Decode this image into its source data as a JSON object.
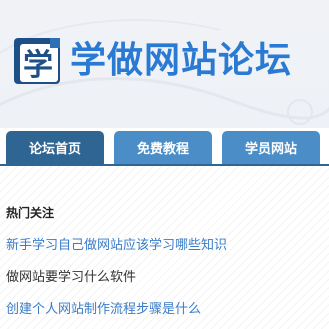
{
  "site": {
    "logo_glyph": "学",
    "title": "学做网站论坛",
    "brand_color": "#2a7ad4"
  },
  "nav": {
    "tabs": [
      {
        "label": "论坛首页",
        "active": true
      },
      {
        "label": "免费教程",
        "active": false
      },
      {
        "label": "学员网站",
        "active": false
      }
    ],
    "active_color": "#2f6592",
    "inactive_color": "#4a8dc7"
  },
  "hot": {
    "title": "热门关注",
    "links": [
      {
        "text": "新手学习自己做网站应该学习哪些知识"
      },
      {
        "text": "做网站要学习什么软件"
      },
      {
        "text": "创建个人网站制作流程步骤是什么"
      }
    ]
  }
}
